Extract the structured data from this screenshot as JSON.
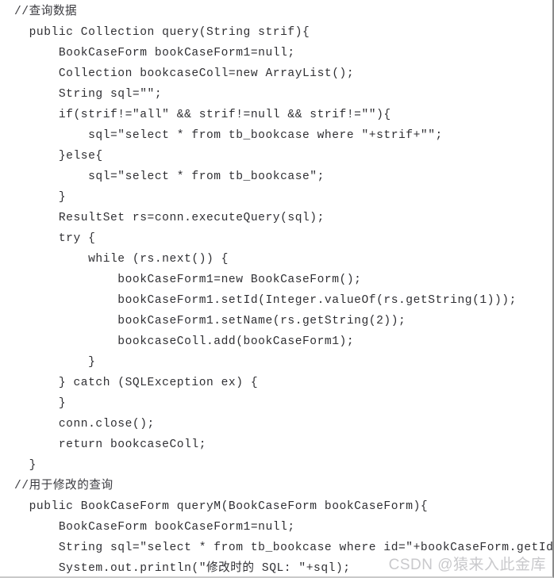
{
  "document": {
    "type": "code-snippet-screenshot",
    "language": "Java",
    "background_color": "#ffffff",
    "text_color": "#2f2f33",
    "border_color": "#8a8a8a"
  },
  "code": {
    "lines": [
      "//查询数据",
      "  public Collection query(String strif){",
      "      BookCaseForm bookCaseForm1=null;",
      "      Collection bookcaseColl=new ArrayList();",
      "      String sql=\"\";",
      "      if(strif!=\"all\" && strif!=null && strif!=\"\"){",
      "          sql=\"select * from tb_bookcase where \"+strif+\"\";",
      "      }else{",
      "          sql=\"select * from tb_bookcase\";",
      "      }",
      "      ResultSet rs=conn.executeQuery(sql);",
      "      try {",
      "          while (rs.next()) {",
      "              bookCaseForm1=new BookCaseForm();",
      "              bookCaseForm1.setId(Integer.valueOf(rs.getString(1)));",
      "              bookCaseForm1.setName(rs.getString(2));",
      "              bookcaseColl.add(bookCaseForm1);",
      "          }",
      "      } catch (SQLException ex) {",
      "      }",
      "      conn.close();",
      "      return bookcaseColl;",
      "  }",
      "//用于修改的查询",
      "  public BookCaseForm queryM(BookCaseForm bookCaseForm){",
      "      BookCaseForm bookCaseForm1=null;",
      "      String sql=\"select * from tb_bookcase where id=\"+bookCaseForm.getId()+\"\";",
      "      System.out.println(\"修改时的 SQL: \"+sql);"
    ],
    "comment_line_indices": [
      0,
      23
    ]
  },
  "watermark": {
    "text": "CSDN @猿来入此金库",
    "color": "#c9c9cc"
  }
}
